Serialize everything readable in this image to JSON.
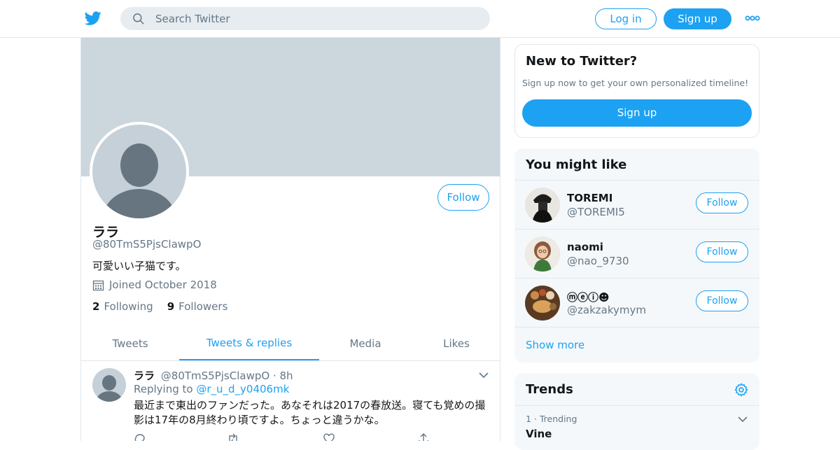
{
  "colors": {
    "accent": "#1da1f2",
    "banner": "#ccd6dd",
    "muted": "#657786",
    "card_bg": "#f5f8fa"
  },
  "topbar": {
    "logo_icon": "twitter-bird-icon",
    "search_placeholder": "Search Twitter",
    "login_label": "Log in",
    "signup_label": "Sign up",
    "more_icon": "more-dots-icon"
  },
  "profile": {
    "name": "ララ",
    "handle": "@80TmS5PjsClawpO",
    "bio": "可愛いい子猫です。",
    "joined": "Joined October 2018",
    "following_count": "2",
    "following_label": "Following",
    "followers_count": "9",
    "followers_label": "Followers",
    "follow_label": "Follow"
  },
  "tabs": [
    {
      "label": "Tweets"
    },
    {
      "label": "Tweets & replies",
      "active": true
    },
    {
      "label": "Media"
    },
    {
      "label": "Likes"
    }
  ],
  "tweet": {
    "name": "ララ",
    "handle": "@80TmS5PjsClawpO",
    "time": "· 8h",
    "replying_prefix": "Replying to",
    "replying_to": "@r_u_d_y0406mk",
    "text": "最近まで東出のファンだった。あなそれは2017の春放送。寝ても覚めの撮影は17年の8月終わり頃ですよ。ちょっと違うかな。"
  },
  "new_to_twitter": {
    "title": "New to Twitter?",
    "subtitle": "Sign up now to get your own personalized timeline!",
    "button": "Sign up"
  },
  "you_might_like": {
    "title": "You might like",
    "items": [
      {
        "name": "TOREMI",
        "handle": "@TOREMI5",
        "follow": "Follow"
      },
      {
        "name": "naomi",
        "handle": "@nao_9730",
        "follow": "Follow"
      },
      {
        "name": "ⓜⓔⓘ☻",
        "handle": "@zakzakymym",
        "follow": "Follow"
      }
    ],
    "show_more": "Show more"
  },
  "trends": {
    "title": "Trends",
    "items": [
      {
        "meta": "1 · Trending",
        "name": "Vine"
      }
    ]
  }
}
